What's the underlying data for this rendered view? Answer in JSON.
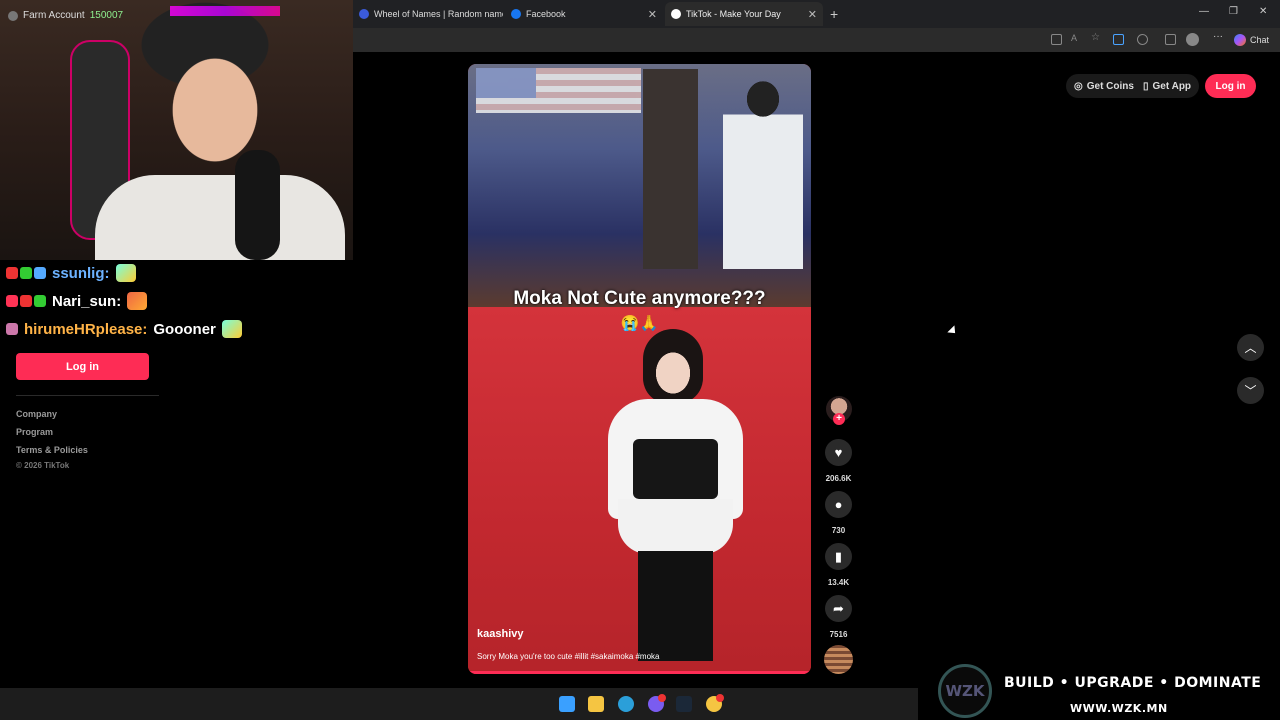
{
  "browser": {
    "tabs": [
      {
        "label": "Wheel of Names | Random name p",
        "favicon_color": "#3b5bdb"
      },
      {
        "label": "Facebook",
        "favicon_color": "#1877f2"
      },
      {
        "label": "TikTok - Make Your Day",
        "favicon_color": "#ffffff"
      }
    ],
    "new_tab_icon": "+",
    "chat_label": "Chat"
  },
  "stream": {
    "webcam_label": "Farm Account",
    "webcam_amount": "150007",
    "chat": [
      {
        "user": "ssunlig:",
        "color": "#6cb2ff",
        "message": ""
      },
      {
        "user": "Nari_sun:",
        "color": "#ffffff",
        "message": ""
      },
      {
        "user": "hirumeHRplease:",
        "color": "#ffb347",
        "message": "Goooner"
      }
    ]
  },
  "tiktok": {
    "left_login": "Log in",
    "footer": [
      "Company",
      "Program",
      "Terms & Policies"
    ],
    "copyright": "© 2026 TikTok",
    "top_right": {
      "coins": "Get Coins",
      "app": "Get App",
      "login": "Log in"
    },
    "accent": "#fe2c55",
    "video": {
      "caption": "Moka Not Cute anymore???",
      "caption_emoji": "😭🙏",
      "author": "kaashivy",
      "description": "Sorry Moka you're too cute #illit #sakaimoka #moka"
    },
    "actions": {
      "likes": "206.6K",
      "comments": "730",
      "saves": "13.4K",
      "shares": "7516"
    }
  },
  "sponsor": {
    "logo_text": "WZK",
    "tagline": "BUILD • UPGRADE • DOMINATE",
    "url": "WWW.WZK.MN"
  }
}
